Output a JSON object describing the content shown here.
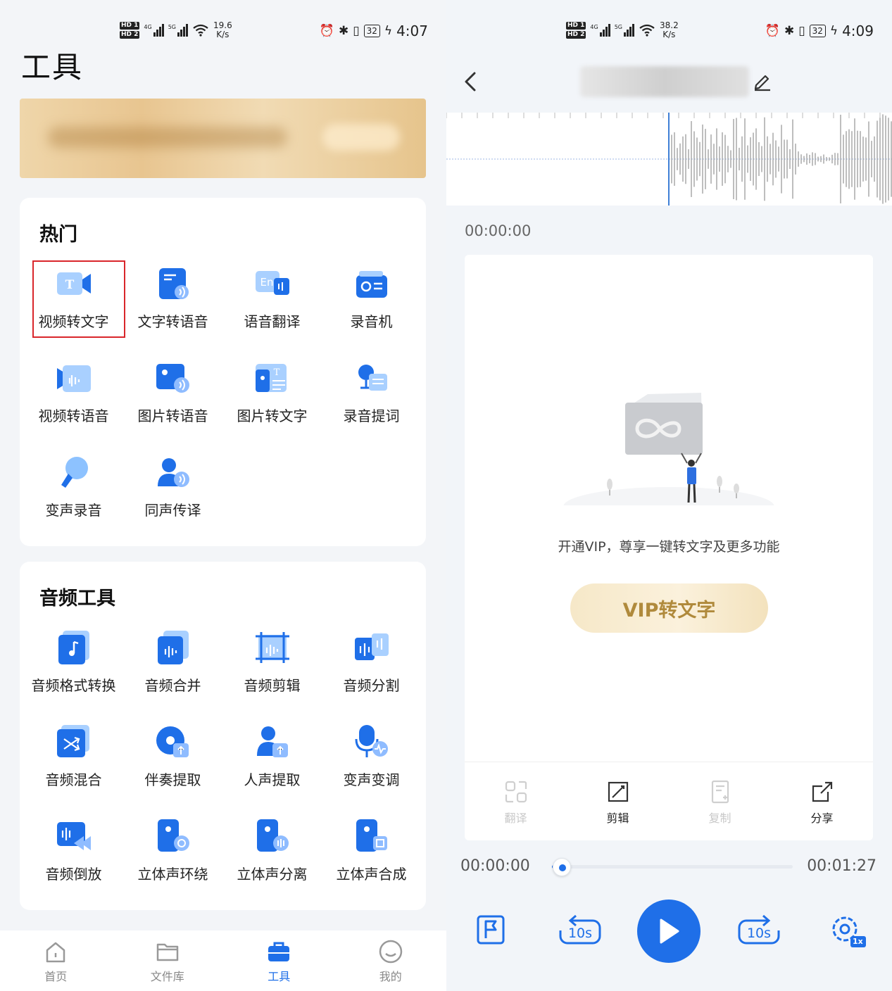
{
  "left": {
    "status": {
      "speed_value": "19.6",
      "speed_unit": "K/s",
      "battery": "32",
      "time": "4:07"
    },
    "page_title": "工具",
    "hot": {
      "title": "热门",
      "items": [
        {
          "label": "视频转文字",
          "icon": "video-to-text-icon"
        },
        {
          "label": "文字转语音",
          "icon": "text-to-speech-icon"
        },
        {
          "label": "语音翻译",
          "icon": "voice-translate-icon"
        },
        {
          "label": "录音机",
          "icon": "recorder-icon"
        },
        {
          "label": "视频转语音",
          "icon": "video-to-speech-icon"
        },
        {
          "label": "图片转语音",
          "icon": "image-to-speech-icon"
        },
        {
          "label": "图片转文字",
          "icon": "image-to-text-icon"
        },
        {
          "label": "录音提词",
          "icon": "teleprompter-icon"
        },
        {
          "label": "变声录音",
          "icon": "voice-changer-record-icon"
        },
        {
          "label": "同声传译",
          "icon": "simultaneous-interpret-icon"
        }
      ]
    },
    "audio": {
      "title": "音频工具",
      "items": [
        {
          "label": "音频格式转换",
          "icon": "audio-format-icon"
        },
        {
          "label": "音频合并",
          "icon": "audio-merge-icon"
        },
        {
          "label": "音频剪辑",
          "icon": "audio-cut-icon"
        },
        {
          "label": "音频分割",
          "icon": "audio-split-icon"
        },
        {
          "label": "音频混合",
          "icon": "audio-mix-icon"
        },
        {
          "label": "伴奏提取",
          "icon": "accompaniment-extract-icon"
        },
        {
          "label": "人声提取",
          "icon": "vocal-extract-icon"
        },
        {
          "label": "变声变调",
          "icon": "pitch-change-icon"
        },
        {
          "label": "音频倒放",
          "icon": "audio-reverse-icon"
        },
        {
          "label": "立体声环绕",
          "icon": "stereo-surround-icon"
        },
        {
          "label": "立体声分离",
          "icon": "stereo-separate-icon"
        },
        {
          "label": "立体声合成",
          "icon": "stereo-compose-icon"
        }
      ]
    },
    "tabs": [
      {
        "label": "首页",
        "icon": "home-icon",
        "active": false
      },
      {
        "label": "文件库",
        "icon": "folder-icon",
        "active": false
      },
      {
        "label": "工具",
        "icon": "toolbox-icon",
        "active": true
      },
      {
        "label": "我的",
        "icon": "profile-icon",
        "active": false
      }
    ],
    "accent": "#1f6fe8",
    "highlight_color": "#d9262b"
  },
  "right": {
    "status": {
      "speed_value": "38.2",
      "speed_unit": "K/s",
      "battery": "32",
      "time": "4:09"
    },
    "time_top": "00:00:00",
    "vip_message": "开通VIP，尊享一键转文字及更多功能",
    "vip_button": "VIP转文字",
    "actions": [
      {
        "label": "翻译",
        "icon": "translate-icon",
        "enabled": false
      },
      {
        "label": "剪辑",
        "icon": "crop-icon",
        "enabled": true
      },
      {
        "label": "复制",
        "icon": "copy-icon",
        "enabled": false
      },
      {
        "label": "分享",
        "icon": "share-icon",
        "enabled": true
      }
    ],
    "current_time": "00:00:00",
    "total_time": "00:01:27",
    "progress": 0.04,
    "skip_back": "10s",
    "skip_forward": "10s",
    "speed_badge": "1x"
  }
}
